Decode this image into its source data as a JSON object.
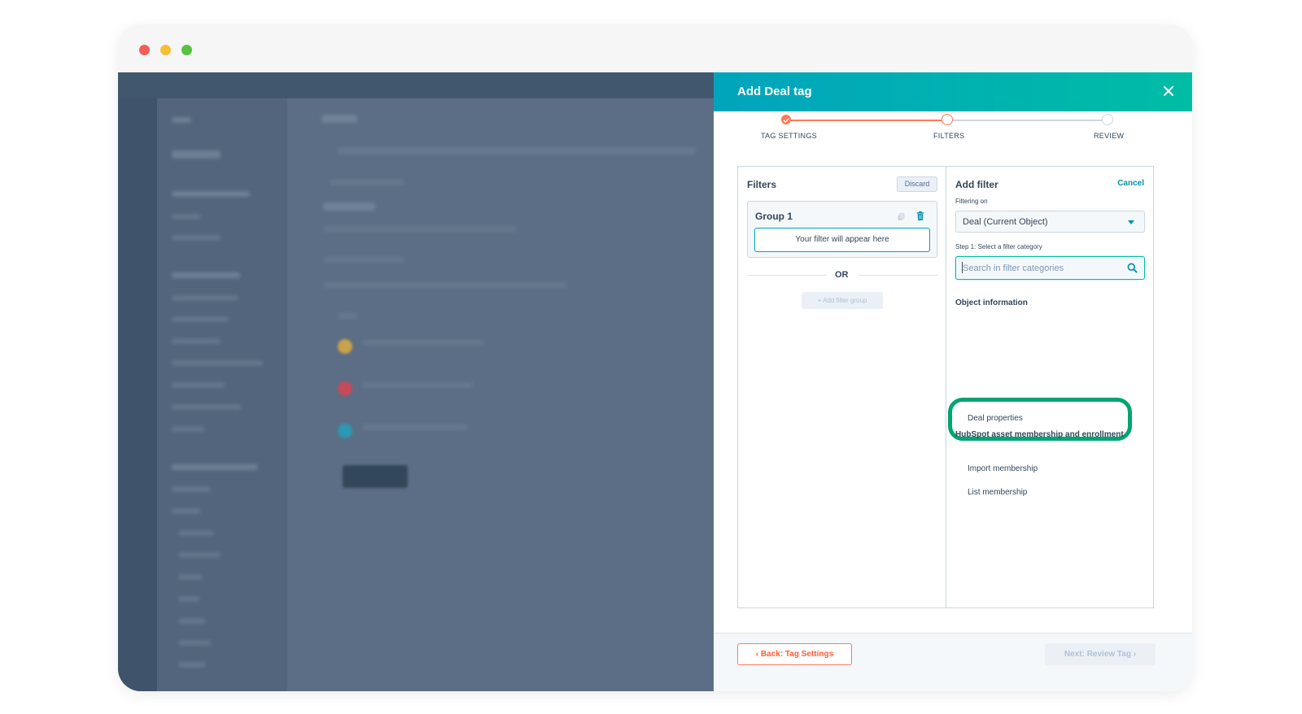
{
  "panel": {
    "title": "Add Deal tag",
    "steps": [
      "TAG SETTINGS",
      "FILTERS",
      "REVIEW"
    ],
    "active_step": 1
  },
  "filters": {
    "heading": "Filters",
    "discard_label": "Discard",
    "group_title": "Group 1",
    "placeholder_text": "Your filter will appear here",
    "or_label": "OR",
    "add_group_label": "+ Add filter group"
  },
  "add_filter": {
    "heading": "Add filter",
    "cancel_label": "Cancel",
    "filtering_on_label": "Filtering on",
    "object_value": "Deal (Current Object)",
    "step1_label": "Step 1: Select a filter category",
    "search_placeholder": "Search in filter categories",
    "categories": [
      {
        "title": "Object information",
        "items": [
          "Deal properties"
        ]
      },
      {
        "title": "HubSpot asset membership and enrollment",
        "items": [
          "Import membership",
          "List membership"
        ]
      }
    ]
  },
  "footer": {
    "back_label": "Back: Tag Settings",
    "next_label": "Next: Review Tag"
  },
  "colors": {
    "header_gradient_start": "#00a4bd",
    "header_gradient_end": "#00bda5",
    "accent_orange": "#ff7a59",
    "highlight_green": "#00a66f",
    "link_blue": "#0091ae"
  },
  "icons": [
    "close-icon",
    "check-icon",
    "copy-icon",
    "trash-icon",
    "chevron-down-icon",
    "search-icon",
    "chevron-left-icon",
    "chevron-right-icon"
  ]
}
